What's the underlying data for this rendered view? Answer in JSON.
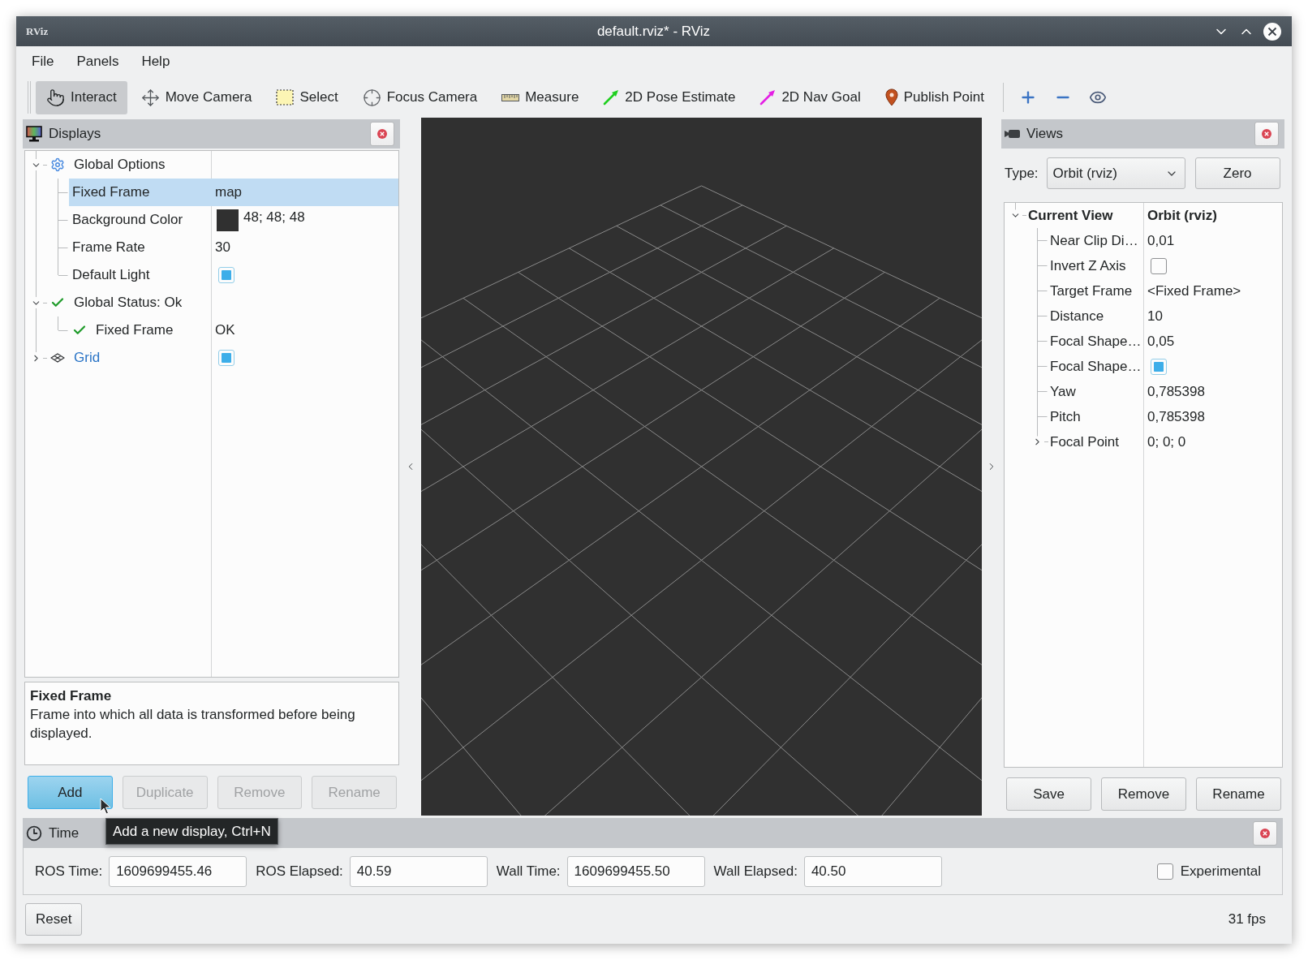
{
  "window": {
    "logo": "RViz",
    "title": "default.rviz* - RViz"
  },
  "menu": [
    {
      "label": "File"
    },
    {
      "label": "Panels"
    },
    {
      "label": "Help"
    }
  ],
  "toolbar": {
    "tools": [
      {
        "label": "Interact",
        "selected": true
      },
      {
        "label": "Move Camera",
        "selected": false
      },
      {
        "label": "Select",
        "selected": false
      },
      {
        "label": "Focus Camera",
        "selected": false
      },
      {
        "label": "Measure",
        "selected": false
      },
      {
        "label": "2D Pose Estimate",
        "selected": false
      },
      {
        "label": "2D Nav Goal",
        "selected": false
      },
      {
        "label": "Publish Point",
        "selected": false
      }
    ]
  },
  "displays": {
    "title": "Displays",
    "tree": [
      {
        "label": "Global Options",
        "kind": "options",
        "expanded": true,
        "selected": false,
        "children": [
          {
            "label": "Fixed Frame",
            "value": "map",
            "selected": true
          },
          {
            "label": "Background Color",
            "value": "48; 48; 48",
            "color": "#303030",
            "selected": false
          },
          {
            "label": "Frame Rate",
            "value": "30",
            "selected": false
          },
          {
            "label": "Default Light",
            "checked": true,
            "selected": false
          }
        ]
      },
      {
        "label": "Global Status: Ok",
        "ok": true,
        "expanded": true,
        "selected": false,
        "children": [
          {
            "label": "Fixed Frame",
            "ok": true,
            "value": "OK",
            "selected": false
          }
        ]
      },
      {
        "label": "Grid",
        "kind": "display",
        "expanded": false,
        "checked": true,
        "selected": false
      }
    ],
    "description": {
      "title": "Fixed Frame",
      "text": "Frame into which all data is transformed before being displayed."
    },
    "buttons": [
      {
        "label": "Add",
        "hovered": true,
        "disabled": false
      },
      {
        "label": "Duplicate",
        "hovered": false,
        "disabled": true
      },
      {
        "label": "Remove",
        "hovered": false,
        "disabled": true
      },
      {
        "label": "Rename",
        "hovered": false,
        "disabled": true
      }
    ]
  },
  "tooltip": {
    "text": "Add a new display, Ctrl+N"
  },
  "views": {
    "title": "Views",
    "type_label": "Type:",
    "type_value": "Orbit (rviz)",
    "zero_button": "Zero",
    "tree": [
      {
        "label": "Current View",
        "value": "Orbit (rviz)",
        "expanded": true,
        "selected": false,
        "children": [
          {
            "label": "Near Clip Di…",
            "value": "0,01",
            "selected": false
          },
          {
            "label": "Invert Z Axis",
            "checked": false,
            "selected": false
          },
          {
            "label": "Target Frame",
            "value": "<Fixed Frame>",
            "selected": false
          },
          {
            "label": "Distance",
            "value": "10",
            "selected": false
          },
          {
            "label": "Focal Shape…",
            "value": "0,05",
            "selected": false
          },
          {
            "label": "Focal Shape…",
            "checked": true,
            "selected": false
          },
          {
            "label": "Yaw",
            "value": "0,785398",
            "selected": false
          },
          {
            "label": "Pitch",
            "value": "0,785398",
            "selected": false
          },
          {
            "label": "Focal Point",
            "value": "0; 0; 0",
            "expanded": false,
            "selected": false
          }
        ]
      }
    ],
    "buttons": [
      {
        "label": "Save"
      },
      {
        "label": "Remove"
      },
      {
        "label": "Rename"
      }
    ]
  },
  "time": {
    "title": "Time",
    "fields": [
      {
        "label": "ROS Time:",
        "value": "1609699455.46"
      },
      {
        "label": "ROS Elapsed:",
        "value": "40.59"
      },
      {
        "label": "Wall Time:",
        "value": "1609699455.50"
      },
      {
        "label": "Wall Elapsed:",
        "value": "40.50"
      }
    ],
    "experimental": {
      "label": "Experimental",
      "checked": false
    }
  },
  "status_bar": {
    "reset_button": "Reset",
    "fps": "31 fps"
  }
}
